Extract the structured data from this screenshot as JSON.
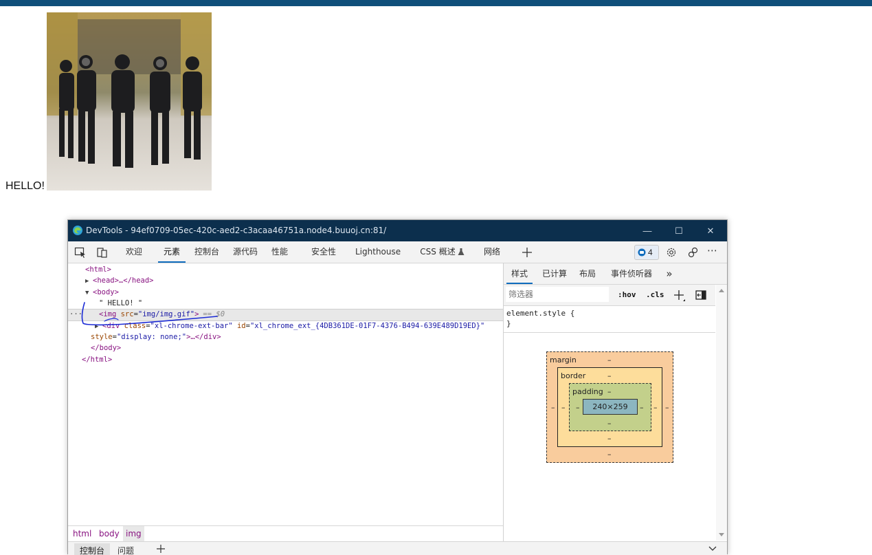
{
  "page": {
    "hello_text": "HELLO!",
    "image_alt": "dancing group gif"
  },
  "devtools": {
    "title": "DevTools - 94ef0709-05ec-420c-aed2-c3acaa46751a.node4.buuoj.cn:81/",
    "window_controls": {
      "minimize": "—",
      "maximize": "☐",
      "close": "✕"
    },
    "tabs": [
      {
        "label": "欢迎"
      },
      {
        "label": "元素"
      },
      {
        "label": "控制台"
      },
      {
        "label": "源代码"
      },
      {
        "label": "性能"
      },
      {
        "label": "安全性"
      },
      {
        "label": "Lighthouse"
      },
      {
        "label": "CSS 概述"
      },
      {
        "label": "网络"
      }
    ],
    "issues_count": "4",
    "dom": {
      "html_open": "<html>",
      "head": "<head>…</head>",
      "body_open": "<body>",
      "text_node": "\" HELLO! \"",
      "img_tag_open": "<img ",
      "img_attr_name": "src",
      "img_attr_value": "\"img/img.gif\"",
      "img_tag_close": ">",
      "selected_marker": "== $0",
      "div_tag": "<div ",
      "div_class_name": "class",
      "div_class_value": "\"xl-chrome-ext-bar\"",
      "div_id_name": "id",
      "div_id_value": "\"xl_chrome_ext_{4DB361DE-01F7-4376-B494-639E489D19ED}\"",
      "div_style_name": "style",
      "div_style_value": "\"display: none;\"",
      "div_close": ">…</div>",
      "body_close": "</body>",
      "html_close": "</html>",
      "row_dots": "···"
    },
    "breadcrumbs": [
      "html",
      "body",
      "img"
    ],
    "drawer_tabs": [
      "控制台",
      "问题"
    ],
    "styles_panel": {
      "tabs": [
        "样式",
        "已计算",
        "布局",
        "事件侦听器"
      ],
      "more": "»",
      "filter_placeholder": "筛选器",
      "hov": ":hov",
      "cls": ".cls",
      "element_style_open": "element.style {",
      "element_style_close": "}"
    },
    "box_model": {
      "margin_label": "margin",
      "border_label": "border",
      "padding_label": "padding",
      "content_size": "240×259",
      "dash": "–"
    },
    "colors": {
      "titlebar": "#0c2f4d",
      "accent": "#0f6cbd",
      "margin": "#f9cc9d",
      "border": "#fddd9b",
      "padding": "#c3d08b",
      "content": "#8cb6c0",
      "annotation_pen": "#1a2ad6"
    }
  }
}
